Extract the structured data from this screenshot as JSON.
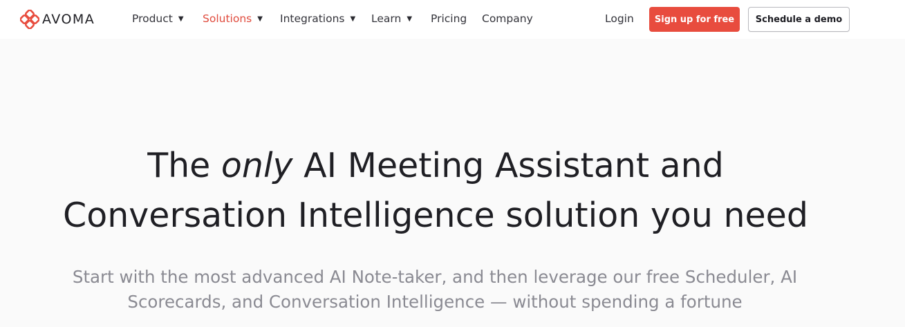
{
  "brand": {
    "name": "AVOMA",
    "accent_color": "#e84c3e",
    "logo_icon": "avoma-logo-icon"
  },
  "nav": {
    "items": [
      {
        "label": "Product",
        "has_dropdown": true
      },
      {
        "label": "Solutions",
        "has_dropdown": true,
        "active": true
      },
      {
        "label": "Integrations",
        "has_dropdown": true
      },
      {
        "label": "Learn",
        "has_dropdown": true
      },
      {
        "label": "Pricing",
        "has_dropdown": false
      },
      {
        "label": "Company",
        "has_dropdown": false
      }
    ],
    "dropdown_icon": "caret-down-icon",
    "login_label": "Login",
    "signup_label": "Sign up for free",
    "demo_label": "Schedule a demo"
  },
  "hero": {
    "title_before": "The ",
    "title_emphasis": "only",
    "title_line1_after": " AI Meeting Assistant and",
    "title_line2": "Conversation Intelligence solution you need",
    "subtitle_line1": "Start with the most advanced AI Note-taker, and then leverage our free Scheduler, AI",
    "subtitle_line2": "Scorecards, and Conversation Intelligence — without spending a fortune"
  }
}
